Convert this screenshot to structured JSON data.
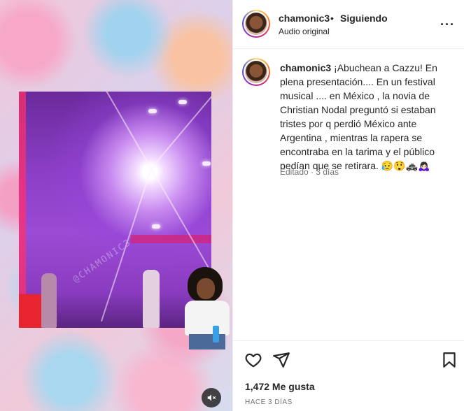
{
  "post": {
    "media": {
      "watermark": "@CHAMONIC3",
      "mute_icon": "speaker-muted-icon"
    },
    "header": {
      "username": "chamonic3",
      "separator": "•",
      "follow_status": "Siguiendo",
      "audio_label": "Audio original",
      "more_icon": "more-options-icon"
    },
    "caption": {
      "username": "chamonic3",
      "text": "¡Abuchean a Cazzu! En plena presentación.... En un festival musical .... en México , la novia de Christian Nodal preguntó si estaban tristes por q perdió México ante Argentina , mientras la rapera se encontraba en la tarima y el público pedían que se retirara. 😥😲🚓🙇🏻‍♀️",
      "meta": "Editado · 3 días"
    },
    "actions": {
      "like_icon": "heart-icon",
      "share_icon": "send-icon",
      "save_icon": "bookmark-icon",
      "likes_text": "1,472 Me gusta",
      "date_text": "HACE 3 DÍAS"
    }
  },
  "colors": {
    "text": "#262626",
    "secondary": "#737373",
    "border": "#efefef"
  }
}
